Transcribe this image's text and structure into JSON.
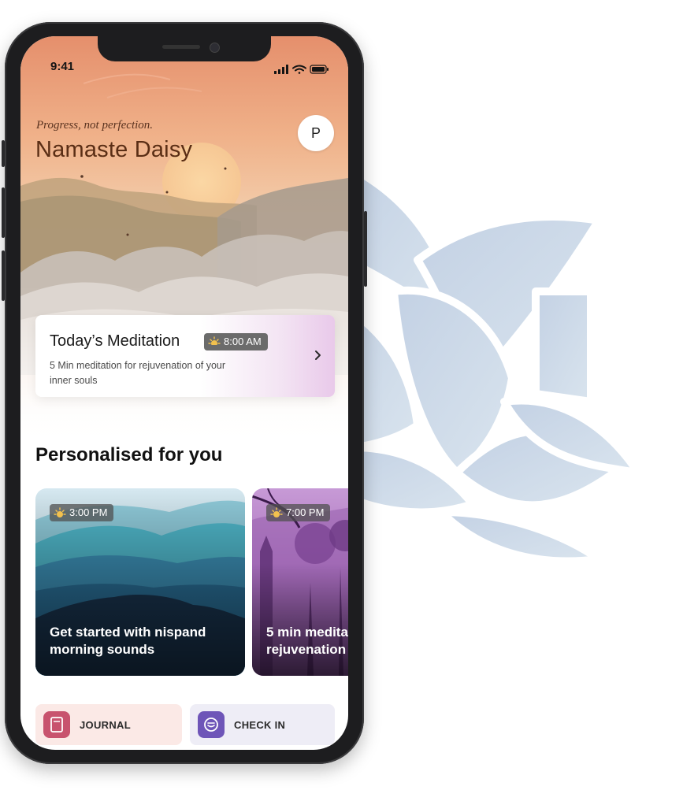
{
  "status_bar": {
    "time": "9:41"
  },
  "header": {
    "quote": "Progress, not perfection.",
    "greeting": "Namaste Daisy",
    "avatar_initial": "P"
  },
  "today": {
    "title": "Today’s Meditation",
    "time": "8:00 AM",
    "description": "5 Min meditation for rejuvenation of your inner souls"
  },
  "section_title": "Personalised for you",
  "cards": [
    {
      "time": "3:00 PM",
      "title_line1": "Get started with nispand",
      "title_line2": "morning sounds"
    },
    {
      "time": "7:00 PM",
      "title_line1": "5 min medita",
      "title_line2": "rejuvenation"
    }
  ],
  "quick_actions": [
    {
      "label": "JOURNAL",
      "icon": "journal-icon"
    },
    {
      "label": "CHECK IN",
      "icon": "check-in-icon"
    }
  ],
  "colors": {
    "sky_top": "#e79a73",
    "lotus": "#c9d6e6",
    "journal_bg": "#fbe9e6",
    "checkin_bg": "#eeedf6"
  }
}
